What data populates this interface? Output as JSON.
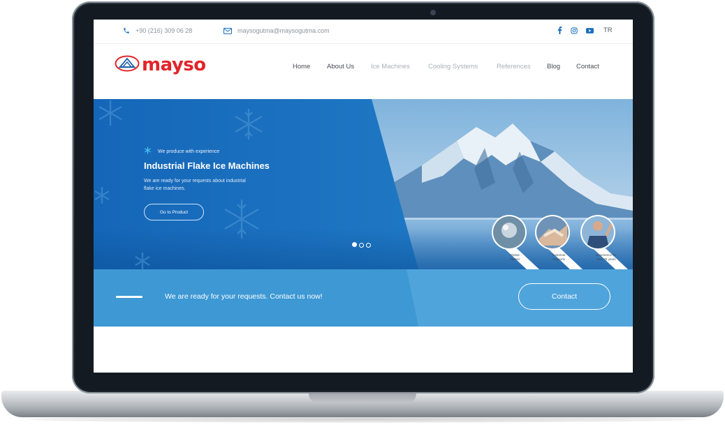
{
  "topbar": {
    "phone": "+90 (216) 309 06 28",
    "email": "maysogutma@maysogutma.com",
    "social_icons": [
      "facebook-icon",
      "instagram-icon",
      "youtube-icon"
    ],
    "language": "TR"
  },
  "brand": {
    "logo_text": "mayso",
    "logo_color": "#e2242a",
    "emblem_color": "#1f5fa8"
  },
  "nav": {
    "items": [
      {
        "label": "Home"
      },
      {
        "label": "About Us"
      },
      {
        "label": "Ice Machines"
      },
      {
        "label": "Cooling Systems"
      },
      {
        "label": "References"
      },
      {
        "label": "Blog"
      },
      {
        "label": "Contact"
      }
    ]
  },
  "hero": {
    "tagline": "We produce with experience",
    "title": "Industrial Flake Ice Machines",
    "description_line1": "We are ready for your requests about industrial",
    "description_line2": "flake ice machines.",
    "button_label": "Go to Product",
    "slide_count": 3,
    "active_slide": 1,
    "features": [
      {
        "label_line1": "Global",
        "label_line2": "Partner"
      },
      {
        "label_line1": "Customer",
        "label_line2": "Supports"
      },
      {
        "label_line1": "Experience for",
        "label_line2": "than 25 years"
      }
    ],
    "colors": {
      "primary_blue": "#1a6fbd",
      "accent_cyan": "#4fc3f7"
    }
  },
  "cta": {
    "text": "We are ready for your requests. Contact us now!",
    "button_label": "Contact",
    "color": "#3d98d4"
  }
}
